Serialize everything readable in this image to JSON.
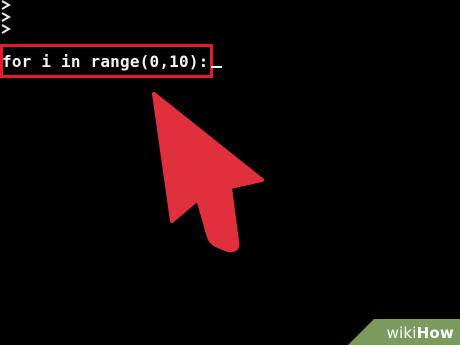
{
  "terminal": {
    "prompt_markers": [
      "",
      "",
      ""
    ],
    "code_text": "for i in range(0,10):",
    "cursor": "_",
    "background_color": "#000000",
    "text_color": "#f2f2f2"
  },
  "annotation": {
    "highlight_color": "#e11d2a",
    "arrow_color": "#e0303d",
    "arrow_icon": "pointer-arrow-icon"
  },
  "watermark": {
    "prefix": "wiki",
    "suffix": "How",
    "background_color": "#7a9a5e"
  }
}
